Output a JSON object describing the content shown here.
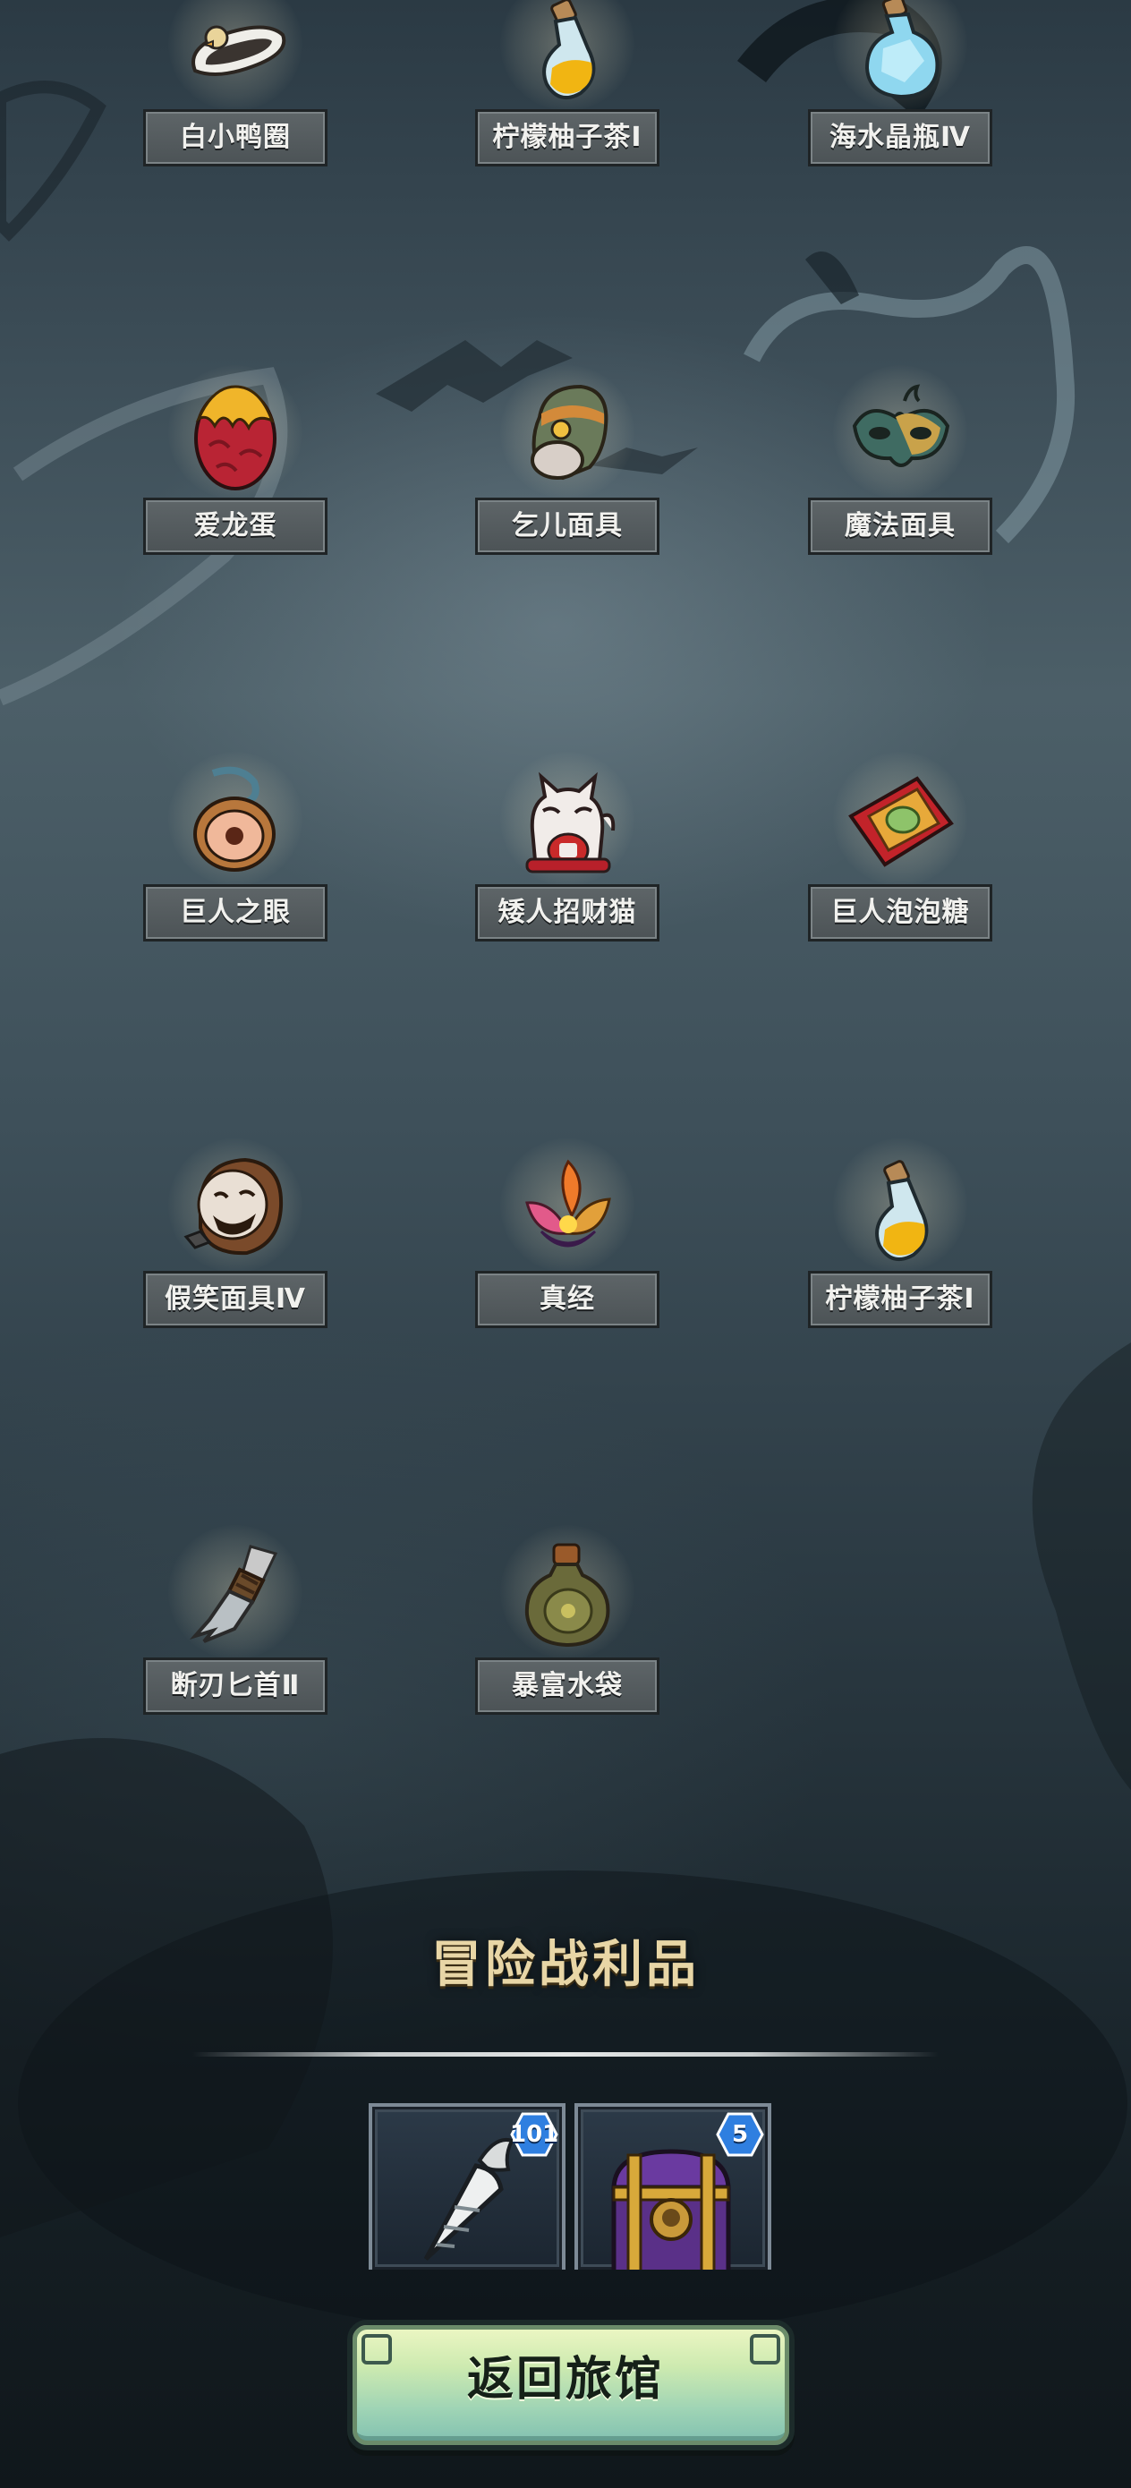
{
  "rewards": [
    {
      "label": "白小鸭圈",
      "icon": "duck-ring-icon"
    },
    {
      "label": "柠檬柚子茶Ⅰ",
      "icon": "lemon-tea-bottle-icon"
    },
    {
      "label": "海水晶瓶Ⅳ",
      "icon": "sea-crystal-bottle-icon"
    },
    {
      "label": "爱龙蛋",
      "icon": "dragon-egg-icon"
    },
    {
      "label": "乞儿面具",
      "icon": "beggar-mask-icon"
    },
    {
      "label": "魔法面具",
      "icon": "magic-mask-icon"
    },
    {
      "label": "巨人之眼",
      "icon": "giant-eye-icon"
    },
    {
      "label": "矮人招财猫",
      "icon": "lucky-cat-icon"
    },
    {
      "label": "巨人泡泡糖",
      "icon": "bubble-gum-icon"
    },
    {
      "label": "假笑面具Ⅳ",
      "icon": "grin-mask-icon"
    },
    {
      "label": "真经",
      "icon": "lotus-scripture-icon"
    },
    {
      "label": "柠檬柚子茶Ⅰ",
      "icon": "lemon-tea-bottle-icon"
    },
    {
      "label": "断刃匕首Ⅱ",
      "icon": "broken-dagger-icon"
    },
    {
      "label": "暴富水袋",
      "icon": "water-pouch-icon"
    }
  ],
  "loot_section": {
    "title": "冒险战利品",
    "items": [
      {
        "icon": "radish-icon",
        "count": "101"
      },
      {
        "icon": "treasure-chest-icon",
        "count": "5"
      }
    ]
  },
  "return_button": {
    "label": "返回旅馆"
  },
  "colors": {
    "label_bg": "#5a6164",
    "title_gold": "#e8d6a6",
    "button_green": "#bfe3b3",
    "badge_blue": "#2f7fe0"
  }
}
